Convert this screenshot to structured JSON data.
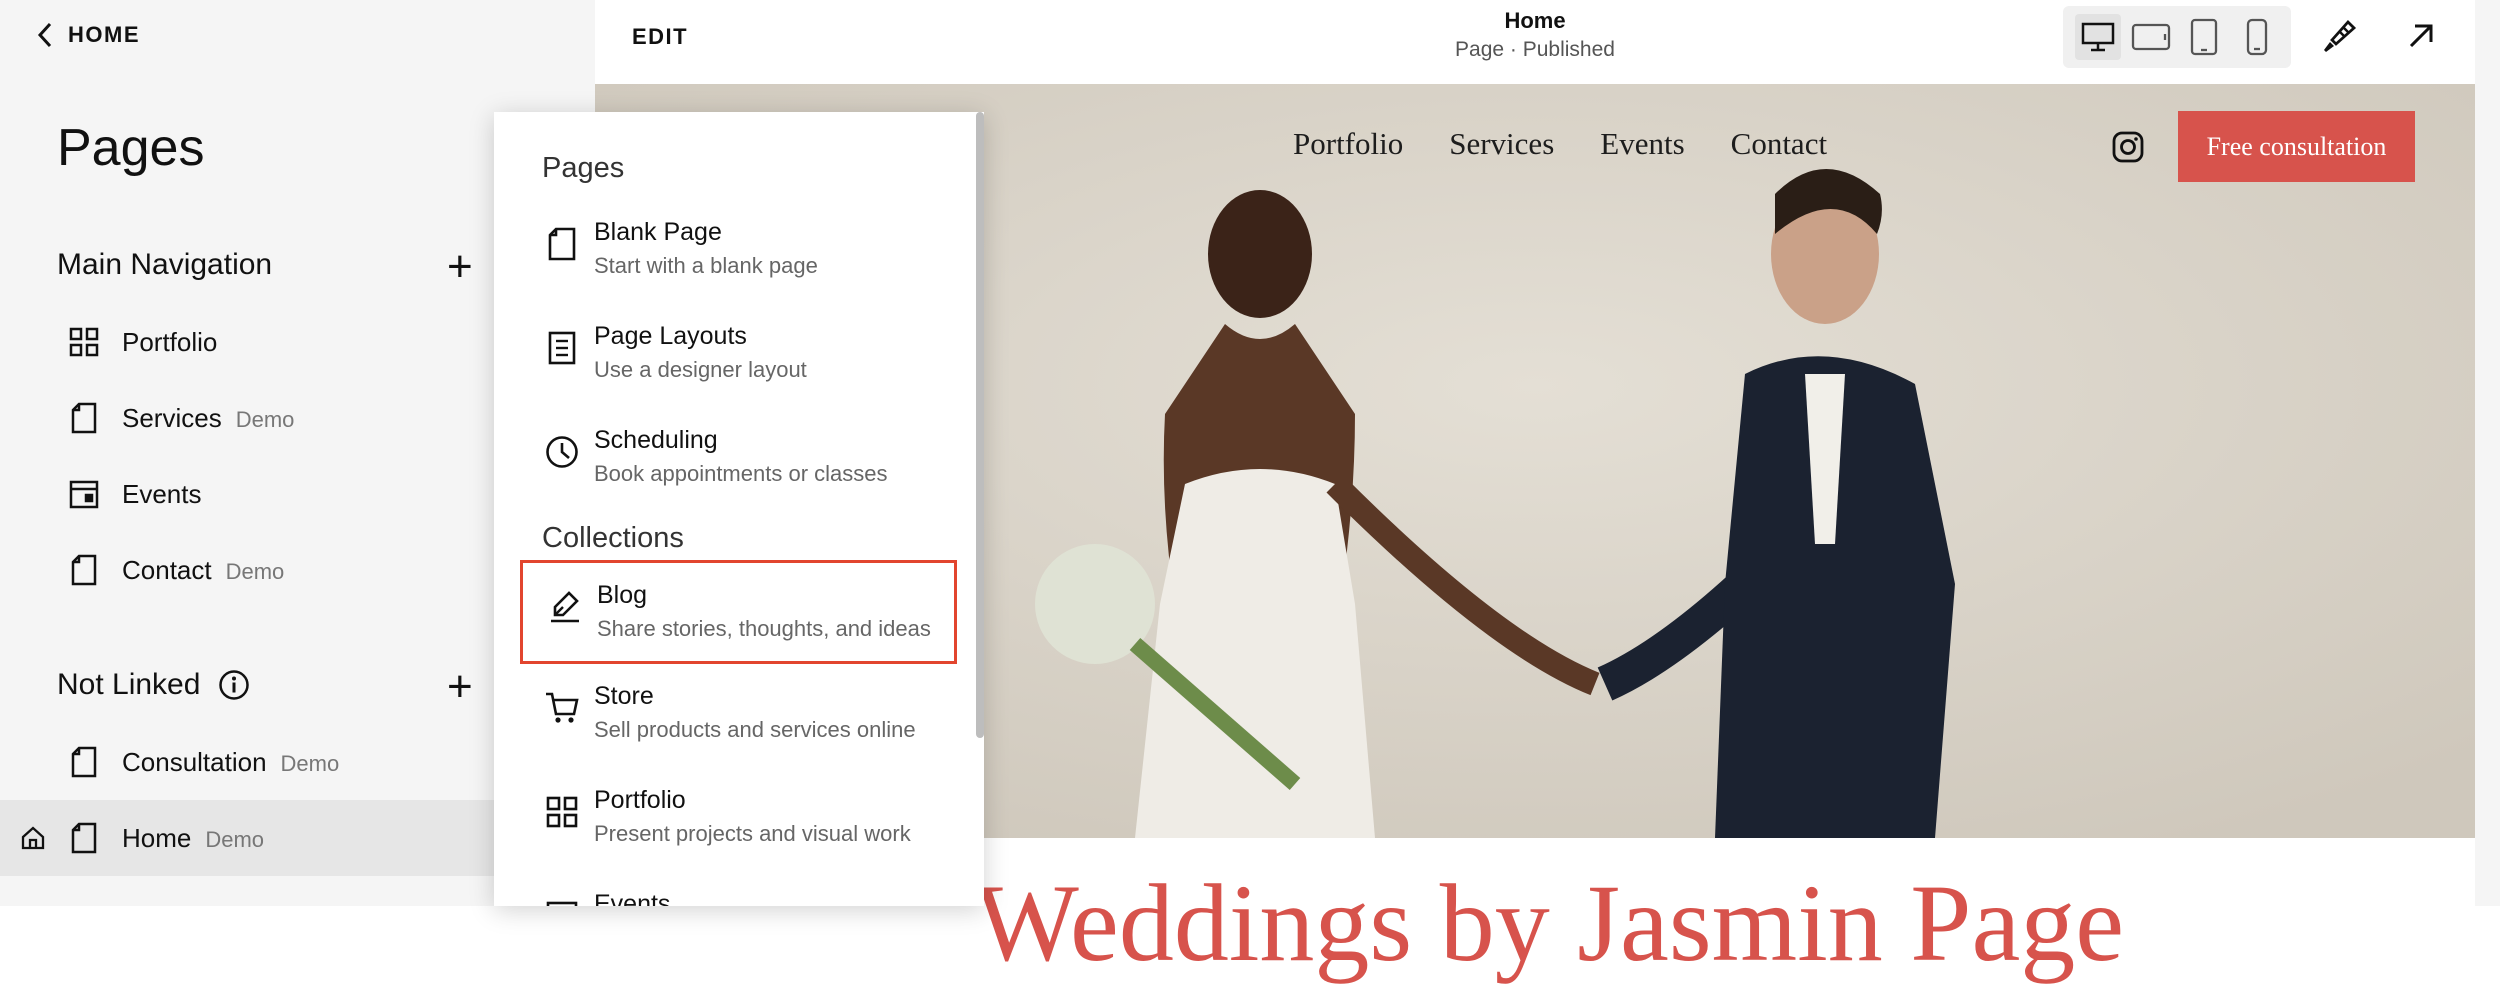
{
  "sidebar": {
    "back_label": "HOME",
    "title": "Pages",
    "main_nav": {
      "label": "Main Navigation",
      "items": [
        {
          "label": "Portfolio",
          "badge": "",
          "icon": "grid-icon"
        },
        {
          "label": "Services",
          "badge": "Demo",
          "icon": "page-icon"
        },
        {
          "label": "Events",
          "badge": "",
          "icon": "calendar-icon"
        },
        {
          "label": "Contact",
          "badge": "Demo",
          "icon": "page-icon"
        }
      ]
    },
    "not_linked": {
      "label": "Not Linked",
      "items": [
        {
          "label": "Consultation",
          "badge": "Demo",
          "icon": "page-icon"
        },
        {
          "label": "Home",
          "badge": "Demo",
          "icon": "page-icon",
          "active": true
        }
      ]
    }
  },
  "topbar": {
    "edit_label": "EDIT",
    "page_title": "Home",
    "page_status": "Page · Published",
    "devices": [
      "desktop-icon",
      "tablet-landscape-icon",
      "tablet-portrait-icon",
      "mobile-icon"
    ],
    "active_device": "desktop-icon"
  },
  "site": {
    "nav": [
      "Portfolio",
      "Services",
      "Events",
      "Contact"
    ],
    "cta_label": "Free consultation",
    "headline_partial": "Weddings by Jasmin Page",
    "accent": "#d7534c"
  },
  "dropdown": {
    "pages_heading": "Pages",
    "collections_heading": "Collections",
    "pages_items": [
      {
        "title": "Blank Page",
        "desc": "Start with a blank page",
        "icon": "blank-page-icon"
      },
      {
        "title": "Page Layouts",
        "desc": "Use a designer layout",
        "icon": "layout-icon"
      },
      {
        "title": "Scheduling",
        "desc": "Book appointments or classes",
        "icon": "clock-icon"
      }
    ],
    "collection_items": [
      {
        "title": "Blog",
        "desc": "Share stories, thoughts, and ideas",
        "icon": "blog-pen-icon",
        "highlight": true
      },
      {
        "title": "Store",
        "desc": "Sell products and services online",
        "icon": "cart-icon"
      },
      {
        "title": "Portfolio",
        "desc": "Present projects and visual work",
        "icon": "grid-icon"
      },
      {
        "title": "Events",
        "desc": "",
        "icon": "calendar-icon"
      }
    ]
  }
}
